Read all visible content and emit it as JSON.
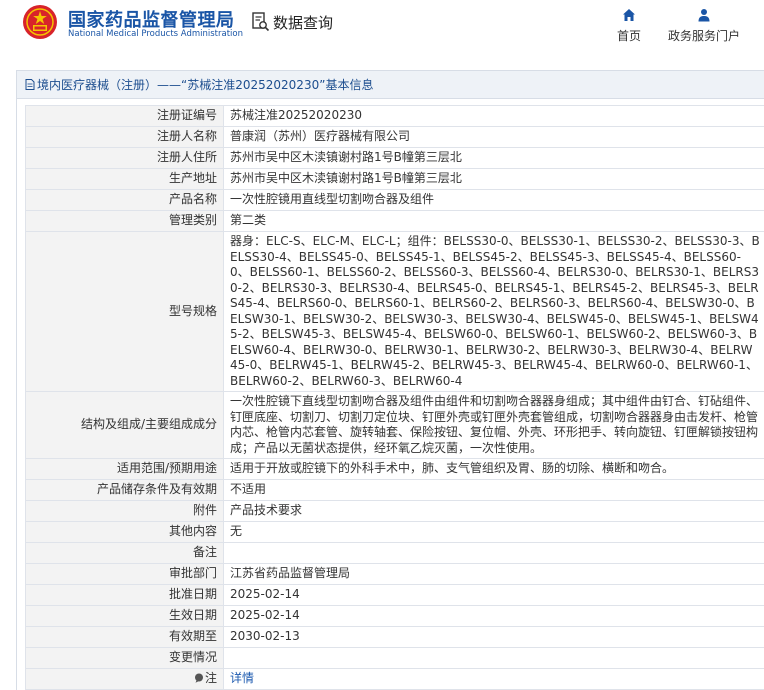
{
  "header": {
    "brand_cn": "国家药品监督管理局",
    "brand_en": "National Medical Products Administration",
    "data_query": "数据查询",
    "nav_home": "首页",
    "nav_portal": "政务服务门户",
    "accent_color": "#1a55a6"
  },
  "panel": {
    "title_prefix": "境内医疗器械（注册）",
    "title_dash": "——",
    "title_record": "“苏械注准20252020230”",
    "title_suffix": "基本信息"
  },
  "rows": [
    {
      "label": "注册证编号",
      "value": "苏械注准20252020230"
    },
    {
      "label": "注册人名称",
      "value": "普康润（苏州）医疗器械有限公司"
    },
    {
      "label": "注册人住所",
      "value": "苏州市吴中区木渎镇谢村路1号B幢第三层北"
    },
    {
      "label": "生产地址",
      "value": "苏州市吴中区木渎镇谢村路1号B幢第三层北"
    },
    {
      "label": "产品名称",
      "value": "一次性腔镜用直线型切割吻合器及组件"
    },
    {
      "label": "管理类别",
      "value": "第二类"
    },
    {
      "label": "型号规格",
      "value": "器身：ELC-S、ELC-M、ELC-L；组件：BELSS30-0、BELSS30-1、BELSS30-2、BELSS30-3、BELSS30-4、BELSS45-0、BELSS45-1、BELSS45-2、BELSS45-3、BELSS45-4、BELSS60-0、BELSS60-1、BELSS60-2、BELSS60-3、BELSS60-4、BELRS30-0、BELRS30-1、BELRS30-2、BELRS30-3、BELRS30-4、BELRS45-0、BELRS45-1、BELRS45-2、BELRS45-3、BELRS45-4、BELRS60-0、BELRS60-1、BELRS60-2、BELRS60-3、BELRS60-4、BELSW30-0、BELSW30-1、BELSW30-2、BELSW30-3、BELSW30-4、BELSW45-0、BELSW45-1、BELSW45-2、BELSW45-3、BELSW45-4、BELSW60-0、BELSW60-1、BELSW60-2、BELSW60-3、BELSW60-4、BELRW30-0、BELRW30-1、BELRW30-2、BELRW30-3、BELRW30-4、BELRW45-0、BELRW45-1、BELRW45-2、BELRW45-3、BELRW45-4、BELRW60-0、BELRW60-1、BELRW60-2、BELRW60-3、BELRW60-4"
    },
    {
      "label": "结构及组成/主要组成成分",
      "value": "一次性腔镜下直线型切割吻合器及组件由组件和切割吻合器器身组成；其中组件由钉合、钉砧组件、钉匣底座、切割刀、切割刀定位块、钉匣外壳或钉匣外壳套管组成，切割吻合器器身由击发杆、枪管内芯、枪管内芯套管、旋转轴套、保险按钮、复位帽、外壳、环形把手、转向旋钮、钉匣解锁按钮构成；产品以无菌状态提供，经环氧乙烷灭菌，一次性使用。"
    },
    {
      "label": "适用范围/预期用途",
      "value": "适用于开放或腔镜下的外科手术中，肺、支气管组织及胃、肠的切除、横断和吻合。"
    },
    {
      "label": "产品储存条件及有效期",
      "value": "不适用"
    },
    {
      "label": "附件",
      "value": "产品技术要求"
    },
    {
      "label": "其他内容",
      "value": "无"
    },
    {
      "label": "备注",
      "value": ""
    },
    {
      "label": "审批部门",
      "value": "江苏省药品监督管理局"
    },
    {
      "label": "批准日期",
      "value": "2025-02-14"
    },
    {
      "label": "生效日期",
      "value": "2025-02-14"
    },
    {
      "label": "有效期至",
      "value": "2030-02-13"
    },
    {
      "label": "变更情况",
      "value": ""
    }
  ],
  "note_row": {
    "label": "注",
    "link": "详情"
  }
}
